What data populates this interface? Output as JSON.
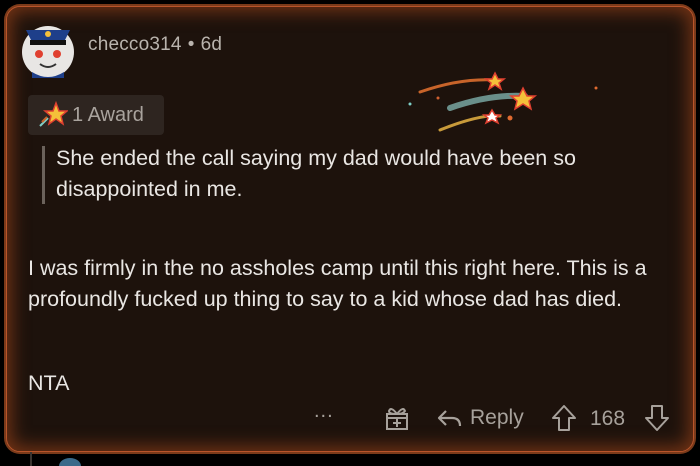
{
  "comment": {
    "author": "checco314",
    "separator": "•",
    "age": "6d",
    "award_label": "1 Award",
    "quote": "She ended the call saying my dad would have been so disappointed in me.",
    "paragraphs": [
      "I was firmly in the no assholes camp until this right here.  This is a profoundly fucked up thing to say to a kid whose dad has died.",
      "NTA"
    ]
  },
  "actions": {
    "more_label": "...",
    "reply_label": "Reply",
    "score": "168"
  },
  "colors": {
    "accent_border": "#b8542a",
    "card_bg": "#1d120c",
    "text": "#e9e6e3",
    "muted": "#a7a19b"
  },
  "icons": [
    "avatar",
    "award-star-icon",
    "shooting-stars-icon",
    "more-icon",
    "gift-icon",
    "reply-icon",
    "upvote-icon",
    "downvote-icon"
  ]
}
